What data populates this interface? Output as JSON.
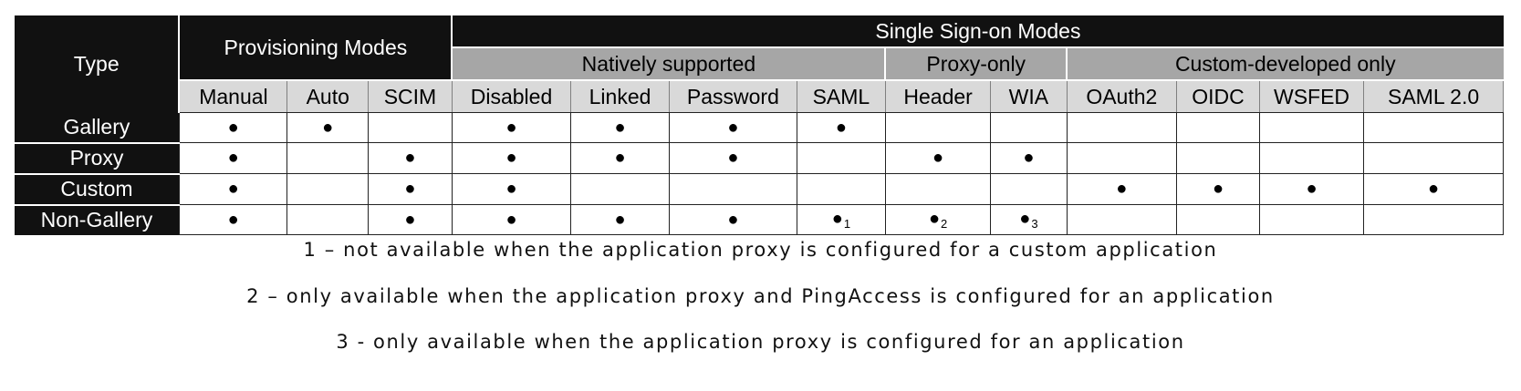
{
  "header": {
    "type": "Type",
    "provisioning": "Provisioning Modes",
    "sso": "Single Sign-on Modes",
    "natively_supported": "Natively supported",
    "proxy_only": "Proxy-only",
    "custom_developed": "Custom-developed only"
  },
  "columns": [
    "Manual",
    "Auto",
    "SCIM",
    "Disabled",
    "Linked",
    "Password",
    "SAML",
    "Header",
    "WIA",
    "OAuth2",
    "OIDC",
    "WSFED",
    "SAML 2.0"
  ],
  "rows": [
    {
      "label": "Gallery",
      "cells": [
        "●",
        "●",
        "",
        "●",
        "●",
        "●",
        "●",
        "",
        "",
        "",
        "",
        "",
        ""
      ]
    },
    {
      "label": "Proxy",
      "cells": [
        "●",
        "",
        "●",
        "●",
        "●",
        "●",
        "",
        "●",
        "●",
        "",
        "",
        "",
        ""
      ]
    },
    {
      "label": "Custom",
      "cells": [
        "●",
        "",
        "●",
        "●",
        "",
        "",
        "",
        "",
        "",
        "●",
        "●",
        "●",
        "●"
      ]
    },
    {
      "label": "Non-Gallery",
      "cells": [
        "●",
        "",
        "●",
        "●",
        "●",
        "●",
        "●",
        "●",
        "●",
        "",
        "",
        "",
        ""
      ]
    }
  ],
  "footnote_marks": {
    "r3c6": "1",
    "r3c7": "2",
    "r3c8": "3"
  },
  "notes": [
    "1 – not available when the application proxy is configured for a custom application",
    "2 – only available when the application proxy and PingAccess is configured for an application",
    "3 - only available when the application proxy is configured for an application"
  ],
  "colors": {
    "header_dark": "#111111",
    "group_gray": "#a6a6a6",
    "column_gray": "#d9d9d9"
  }
}
